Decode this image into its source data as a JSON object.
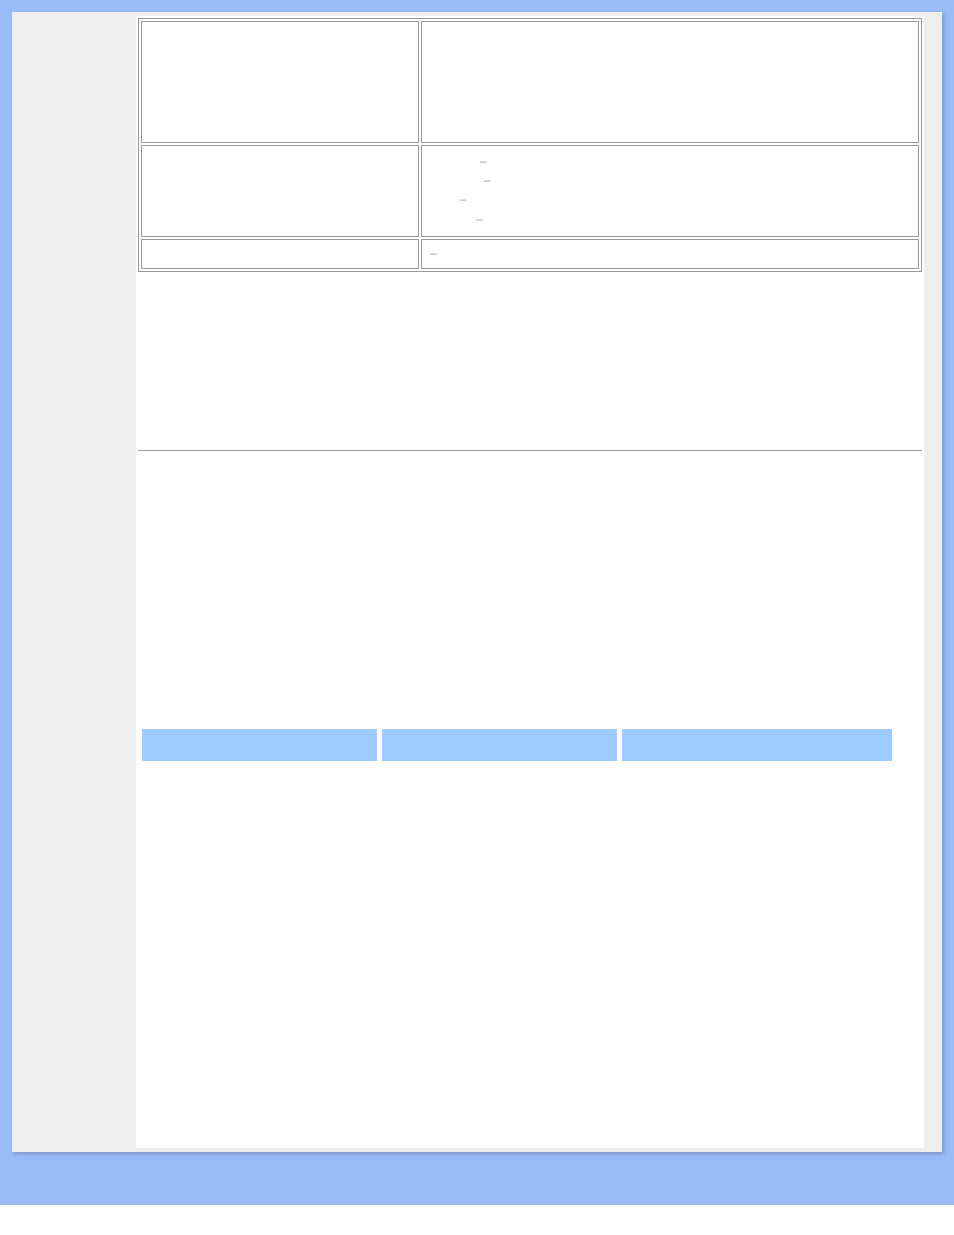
{
  "metaTable": {
    "rows": [
      {
        "label": "",
        "value": ""
      },
      {
        "label": "",
        "value_list": [
          "–",
          "–",
          "–",
          "–"
        ]
      },
      {
        "label": "",
        "value": "–"
      }
    ]
  },
  "tabs": [
    {
      "label": ""
    },
    {
      "label": ""
    },
    {
      "label": ""
    }
  ]
}
